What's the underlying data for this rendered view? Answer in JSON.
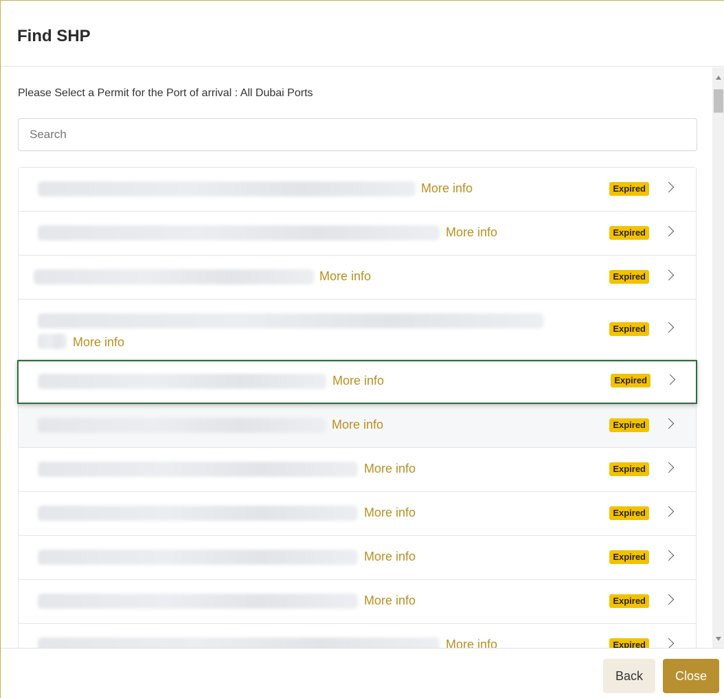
{
  "modal": {
    "title": "Find SHP",
    "prompt": "Please Select a Permit for the Port of arrival : All Dubai Ports",
    "search_placeholder": "Search",
    "more_info_label": "More info",
    "status_label": "Expired",
    "rows": [
      {
        "status": "Expired",
        "more_info": "More info"
      },
      {
        "status": "Expired",
        "more_info": "More info"
      },
      {
        "status": "Expired",
        "more_info": "More info"
      },
      {
        "status": "Expired",
        "more_info": "More info"
      },
      {
        "status": "Expired",
        "more_info": "More info"
      },
      {
        "status": "Expired",
        "more_info": "More info"
      },
      {
        "status": "Expired",
        "more_info": "More info"
      },
      {
        "status": "Expired",
        "more_info": "More info"
      },
      {
        "status": "Expired",
        "more_info": "More info"
      },
      {
        "status": "Expired",
        "more_info": "More info"
      },
      {
        "status": "Expired",
        "more_info": "More info"
      }
    ]
  },
  "footer": {
    "back_label": "Back",
    "close_label": "Close"
  },
  "colors": {
    "accent": "#b8902f",
    "badge": "#f2c200",
    "link": "#bb8f1f",
    "selected_border": "#2f6a3a"
  }
}
